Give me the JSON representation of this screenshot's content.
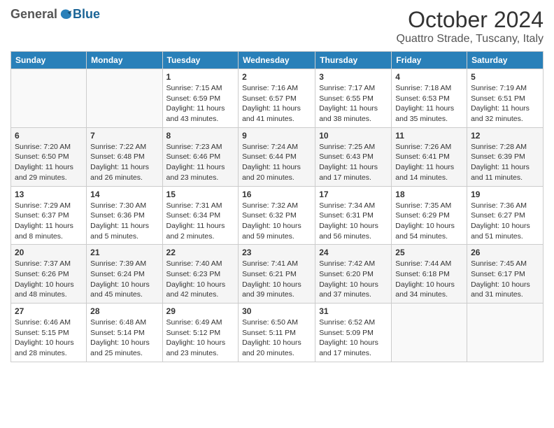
{
  "header": {
    "logo": {
      "general": "General",
      "blue": "Blue",
      "tagline": ""
    },
    "title": "October 2024",
    "location": "Quattro Strade, Tuscany, Italy"
  },
  "days_of_week": [
    "Sunday",
    "Monday",
    "Tuesday",
    "Wednesday",
    "Thursday",
    "Friday",
    "Saturday"
  ],
  "weeks": [
    [
      {
        "day": "",
        "info": ""
      },
      {
        "day": "",
        "info": ""
      },
      {
        "day": "1",
        "info": "Sunrise: 7:15 AM\nSunset: 6:59 PM\nDaylight: 11 hours and 43 minutes."
      },
      {
        "day": "2",
        "info": "Sunrise: 7:16 AM\nSunset: 6:57 PM\nDaylight: 11 hours and 41 minutes."
      },
      {
        "day": "3",
        "info": "Sunrise: 7:17 AM\nSunset: 6:55 PM\nDaylight: 11 hours and 38 minutes."
      },
      {
        "day": "4",
        "info": "Sunrise: 7:18 AM\nSunset: 6:53 PM\nDaylight: 11 hours and 35 minutes."
      },
      {
        "day": "5",
        "info": "Sunrise: 7:19 AM\nSunset: 6:51 PM\nDaylight: 11 hours and 32 minutes."
      }
    ],
    [
      {
        "day": "6",
        "info": "Sunrise: 7:20 AM\nSunset: 6:50 PM\nDaylight: 11 hours and 29 minutes."
      },
      {
        "day": "7",
        "info": "Sunrise: 7:22 AM\nSunset: 6:48 PM\nDaylight: 11 hours and 26 minutes."
      },
      {
        "day": "8",
        "info": "Sunrise: 7:23 AM\nSunset: 6:46 PM\nDaylight: 11 hours and 23 minutes."
      },
      {
        "day": "9",
        "info": "Sunrise: 7:24 AM\nSunset: 6:44 PM\nDaylight: 11 hours and 20 minutes."
      },
      {
        "day": "10",
        "info": "Sunrise: 7:25 AM\nSunset: 6:43 PM\nDaylight: 11 hours and 17 minutes."
      },
      {
        "day": "11",
        "info": "Sunrise: 7:26 AM\nSunset: 6:41 PM\nDaylight: 11 hours and 14 minutes."
      },
      {
        "day": "12",
        "info": "Sunrise: 7:28 AM\nSunset: 6:39 PM\nDaylight: 11 hours and 11 minutes."
      }
    ],
    [
      {
        "day": "13",
        "info": "Sunrise: 7:29 AM\nSunset: 6:37 PM\nDaylight: 11 hours and 8 minutes."
      },
      {
        "day": "14",
        "info": "Sunrise: 7:30 AM\nSunset: 6:36 PM\nDaylight: 11 hours and 5 minutes."
      },
      {
        "day": "15",
        "info": "Sunrise: 7:31 AM\nSunset: 6:34 PM\nDaylight: 11 hours and 2 minutes."
      },
      {
        "day": "16",
        "info": "Sunrise: 7:32 AM\nSunset: 6:32 PM\nDaylight: 10 hours and 59 minutes."
      },
      {
        "day": "17",
        "info": "Sunrise: 7:34 AM\nSunset: 6:31 PM\nDaylight: 10 hours and 56 minutes."
      },
      {
        "day": "18",
        "info": "Sunrise: 7:35 AM\nSunset: 6:29 PM\nDaylight: 10 hours and 54 minutes."
      },
      {
        "day": "19",
        "info": "Sunrise: 7:36 AM\nSunset: 6:27 PM\nDaylight: 10 hours and 51 minutes."
      }
    ],
    [
      {
        "day": "20",
        "info": "Sunrise: 7:37 AM\nSunset: 6:26 PM\nDaylight: 10 hours and 48 minutes."
      },
      {
        "day": "21",
        "info": "Sunrise: 7:39 AM\nSunset: 6:24 PM\nDaylight: 10 hours and 45 minutes."
      },
      {
        "day": "22",
        "info": "Sunrise: 7:40 AM\nSunset: 6:23 PM\nDaylight: 10 hours and 42 minutes."
      },
      {
        "day": "23",
        "info": "Sunrise: 7:41 AM\nSunset: 6:21 PM\nDaylight: 10 hours and 39 minutes."
      },
      {
        "day": "24",
        "info": "Sunrise: 7:42 AM\nSunset: 6:20 PM\nDaylight: 10 hours and 37 minutes."
      },
      {
        "day": "25",
        "info": "Sunrise: 7:44 AM\nSunset: 6:18 PM\nDaylight: 10 hours and 34 minutes."
      },
      {
        "day": "26",
        "info": "Sunrise: 7:45 AM\nSunset: 6:17 PM\nDaylight: 10 hours and 31 minutes."
      }
    ],
    [
      {
        "day": "27",
        "info": "Sunrise: 6:46 AM\nSunset: 5:15 PM\nDaylight: 10 hours and 28 minutes."
      },
      {
        "day": "28",
        "info": "Sunrise: 6:48 AM\nSunset: 5:14 PM\nDaylight: 10 hours and 25 minutes."
      },
      {
        "day": "29",
        "info": "Sunrise: 6:49 AM\nSunset: 5:12 PM\nDaylight: 10 hours and 23 minutes."
      },
      {
        "day": "30",
        "info": "Sunrise: 6:50 AM\nSunset: 5:11 PM\nDaylight: 10 hours and 20 minutes."
      },
      {
        "day": "31",
        "info": "Sunrise: 6:52 AM\nSunset: 5:09 PM\nDaylight: 10 hours and 17 minutes."
      },
      {
        "day": "",
        "info": ""
      },
      {
        "day": "",
        "info": ""
      }
    ]
  ]
}
